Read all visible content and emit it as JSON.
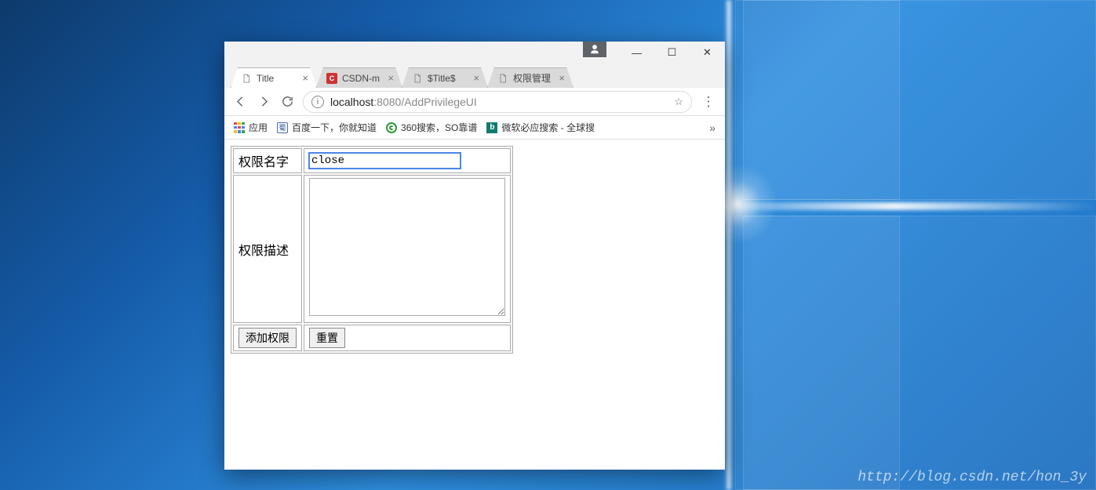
{
  "window": {
    "minimize": "—",
    "maximize": "☐",
    "close": "✕"
  },
  "tabs": [
    {
      "label": "Title",
      "icon": "page"
    },
    {
      "label": "CSDN-m",
      "icon": "csdn"
    },
    {
      "label": "$Title$",
      "icon": "page"
    },
    {
      "label": "权限管理",
      "icon": "page"
    }
  ],
  "address": {
    "host": "localhost",
    "port": ":8080",
    "path": "/AddPrivilegeUI"
  },
  "bookmarks": {
    "apps": "应用",
    "baidu": "百度一下，你就知道",
    "so360": "360搜索，SO靠谱",
    "bing": "微软必应搜索 - 全球搜"
  },
  "form": {
    "name_label": "权限名字",
    "name_value": "close ",
    "desc_label": "权限描述",
    "desc_value": "",
    "submit": "添加权限",
    "reset": "重置"
  },
  "watermark": "http://blog.csdn.net/hon_3y"
}
